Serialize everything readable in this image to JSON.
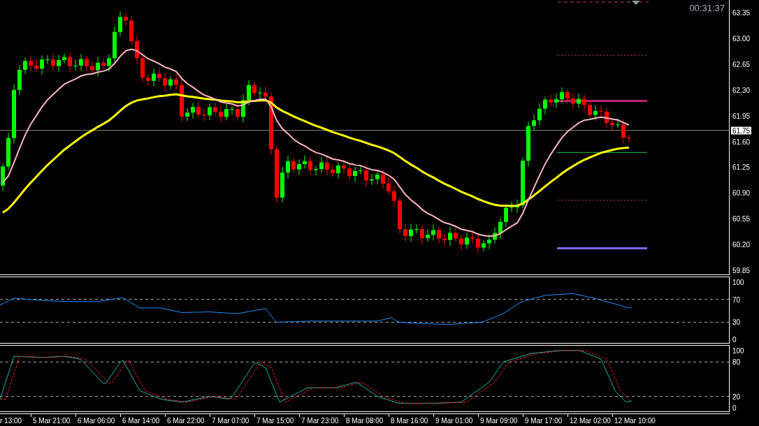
{
  "main_chart": {
    "timer": "00:31:37",
    "current_price": "61.75",
    "price_axis": [
      "63.35",
      "63.00",
      "62.65",
      "62.30",
      "61.95",
      "61.60",
      "61.25",
      "60.90",
      "60.55",
      "60.20",
      "59.85"
    ]
  },
  "rsi_panel": {
    "axis": [
      "100",
      "70",
      "30",
      "0"
    ]
  },
  "stochastic_panel": {
    "axis": [
      "100",
      "80",
      "20",
      "0"
    ]
  },
  "time_axis": [
    "r 13:00",
    "5 Mar 21:00",
    "6 Mar 06:00",
    "6 Mar 14:00",
    "6 Mar 22:00",
    "7 Mar 07:00",
    "7 Mar 15:00",
    "7 Mar 23:00",
    "8 Mar 08:00",
    "8 Mar 16:00",
    "9 Mar 01:00",
    "9 Mar 09:00",
    "9 Mar 17:00",
    "12 Mar 02:00",
    "12 Mar 10:00"
  ]
}
